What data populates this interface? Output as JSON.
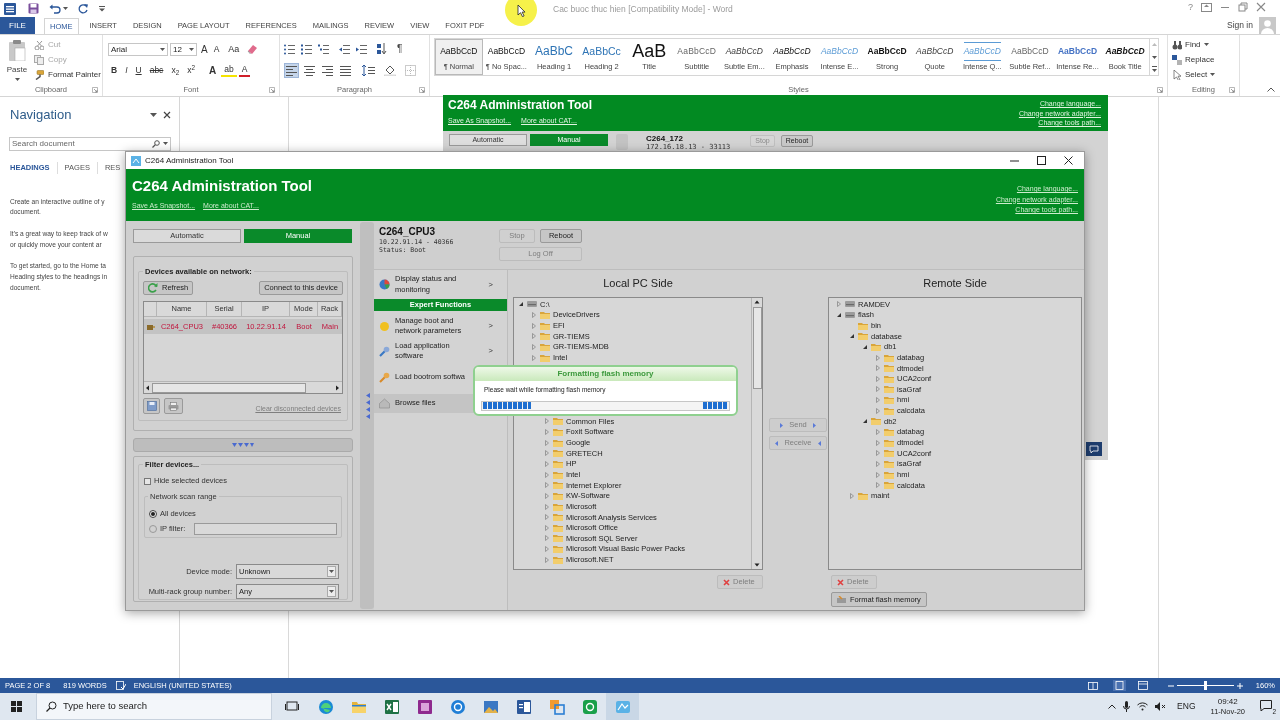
{
  "word": {
    "title": "Cac buoc thuc hien [Compatibility Mode] - Word",
    "help": "?",
    "file_tab": "FILE",
    "tabs": [
      {
        "label": "HOME",
        "selected": true
      },
      {
        "label": "INSERT",
        "selected": false
      },
      {
        "label": "DESIGN",
        "selected": false
      },
      {
        "label": "PAGE LAYOUT",
        "selected": false
      },
      {
        "label": "REFERENCES",
        "selected": false
      },
      {
        "label": "MAILINGS",
        "selected": false
      },
      {
        "label": "REVIEW",
        "selected": false
      },
      {
        "label": "VIEW",
        "selected": false
      },
      {
        "label": "FOXIT PDF",
        "selected": false
      }
    ],
    "sign_in": "Sign in",
    "clipboard": {
      "paste": "Paste",
      "items": [
        {
          "label": "Cut",
          "disabled": true
        },
        {
          "label": "Copy",
          "disabled": true
        },
        {
          "label": "Format Painter",
          "disabled": false
        }
      ],
      "group": "Clipboard"
    },
    "font": {
      "name": "Arial",
      "size": "12",
      "row1": [
        {
          "text": "A",
          "kind": "grow"
        },
        {
          "text": "A",
          "kind": "shrink"
        },
        {
          "text": "Aa",
          "kind": "case"
        }
      ],
      "row2": [
        {
          "text": "B",
          "kind": "bold"
        },
        {
          "text": "I",
          "kind": "italic"
        },
        {
          "text": "U",
          "kind": "underline"
        },
        {
          "text": "abc",
          "kind": "strike"
        },
        {
          "text": "x$_{2}$",
          "kind": "subscript"
        },
        {
          "text": "x$^{2}$",
          "kind": "superscript"
        },
        {
          "text": "A",
          "kind": "effects"
        },
        {
          "text": "ab",
          "kind": "highlight"
        },
        {
          "text": "A",
          "kind": "color"
        }
      ],
      "group": "Font"
    },
    "paragraph": {
      "marks": "¶",
      "alignments": [
        {
          "kind": "left",
          "selected": true
        },
        {
          "kind": "center",
          "selected": false
        },
        {
          "kind": "right",
          "selected": false
        },
        {
          "kind": "justify",
          "selected": false
        }
      ],
      "group": "Paragraph"
    },
    "styles": {
      "items": [
        {
          "preview": "AaBbCcD",
          "label": "¶ Normal",
          "kind": "normal",
          "selected": true
        },
        {
          "preview": "AaBbCcD",
          "label": "¶ No Spac...",
          "kind": "normal",
          "selected": false
        },
        {
          "preview": "AaBbC",
          "label": "Heading 1",
          "kind": "heading1",
          "selected": false
        },
        {
          "preview": "AaBbCc",
          "label": "Heading 2",
          "kind": "heading2",
          "selected": false
        },
        {
          "preview": "AaB",
          "label": "Title",
          "kind": "title",
          "selected": false
        },
        {
          "preview": "AaBbCcD",
          "label": "Subtitle",
          "kind": "subtitle",
          "selected": false
        },
        {
          "preview": "AaBbCcD",
          "label": "Subtle Em...",
          "kind": "subtleemphasis",
          "selected": false
        },
        {
          "preview": "AaBbCcD",
          "label": "Emphasis",
          "kind": "emphasis",
          "selected": false
        },
        {
          "preview": "AaBbCcD",
          "label": "Intense E...",
          "kind": "intenseemphasis",
          "selected": false
        },
        {
          "preview": "AaBbCcD",
          "label": "Strong",
          "kind": "strong",
          "selected": false
        },
        {
          "preview": "AaBbCcD",
          "label": "Quote",
          "kind": "quote",
          "selected": false
        },
        {
          "preview": "AaBbCcD",
          "label": "Intense Q...",
          "kind": "intensequote",
          "selected": false
        },
        {
          "preview": "AaBbCcD",
          "label": "Subtle Ref...",
          "kind": "subtlereference",
          "selected": false
        },
        {
          "preview": "AaBbCcD",
          "label": "Intense Re...",
          "kind": "intensereference",
          "selected": false
        },
        {
          "preview": "AaBbCcD",
          "label": "Book Title",
          "kind": "booktitle",
          "selected": false
        }
      ],
      "group": "Styles"
    },
    "editing": {
      "items": [
        "Find",
        "Replace",
        "Select"
      ],
      "group": "Editing"
    }
  },
  "navigation": {
    "title": "Navigation",
    "search": {
      "placeholder": "Search document"
    },
    "tabs": [
      {
        "label": "HEADINGS",
        "selected": true
      },
      {
        "label": "PAGES",
        "selected": false
      },
      {
        "label": "RES",
        "selected": false
      }
    ],
    "paragraphs": [
      "Create an interactive outline of y\ndocument.",
      "It's a great way to keep track of w\nor quickly move your content ar",
      "To get started, go to the Home ta\nHeading styles to the headings in\ndocument."
    ]
  },
  "background_window": {
    "heading": "C264 Administration Tool",
    "links": [
      "Save As Snapshot...",
      "More about CAT..."
    ],
    "settings_links": [
      "Change language...",
      "Change network adapter...",
      "Change tools path..."
    ],
    "mode_tabs": [
      {
        "label": "Automatic",
        "selected": false
      },
      {
        "label": "Manual",
        "selected": true
      }
    ],
    "device": {
      "name": "C264_172",
      "address": "172.16.18.13 - 33113"
    },
    "buttons": [
      {
        "label": "Stop",
        "disabled": true
      },
      {
        "label": "Reboot",
        "disabled": false
      }
    ]
  },
  "admin_window": {
    "title": "C264 Administration Tool",
    "heading": "C264 Administration Tool",
    "links": [
      "Save As Snapshot...",
      "More about CAT..."
    ],
    "settings_links": [
      "Change language...",
      "Change network adapter...",
      "Change tools path..."
    ],
    "mode_tabs": [
      {
        "label": "Automatic",
        "selected": false
      },
      {
        "label": "Manual",
        "selected": true
      }
    ],
    "devices": {
      "title": "Devices available on network:",
      "refresh": "Refresh",
      "connect": "Connect to this device",
      "columns": [
        "Name",
        "Serial",
        "IP",
        "Mode",
        "Rack"
      ],
      "rows": [
        {
          "cells": [
            "C264_CPU3",
            "#40366",
            "10.22.91.14",
            "Boot",
            "Main"
          ],
          "selected": true
        }
      ],
      "clear_link": "Clear disconnected devices"
    },
    "filter": {
      "title": "Filter devices...",
      "hide_selected": {
        "label": "Hide selected devices",
        "checked": false
      },
      "scan_range": {
        "title": "Network scan range",
        "options": [
          {
            "label": "All devices",
            "selected": true
          },
          {
            "label": "IP filter:",
            "selected": false
          }
        ]
      },
      "device_mode": {
        "label": "Device mode:",
        "value": "Unknown"
      },
      "rack_group": {
        "label": "Multi-rack group number:",
        "value": "Any"
      }
    },
    "device": {
      "name": "C264_CPU3",
      "address": "10.22.91.14 - 40366",
      "status": "Status: Boot",
      "buttons": [
        {
          "label": "Stop",
          "disabled": true
        },
        {
          "label": "Reboot",
          "disabled": false
        },
        {
          "label": "Log Off",
          "disabled": true
        }
      ]
    },
    "menu": [
      {
        "label": "Display status and monitoring",
        "arrow": ">",
        "selected": false
      }
    ],
    "expert_header": "Expert Functions",
    "expert_menu": [
      {
        "label": "Manage boot and network parameters",
        "arrow": ">",
        "selected": false
      },
      {
        "label": "Load application software",
        "arrow": ">",
        "selected": false
      },
      {
        "label": "Load bootrom softwa",
        "selected": false
      },
      {
        "label": "Browse files",
        "selected": true
      }
    ],
    "local": {
      "title": "Local PC Side",
      "tree": [
        {
          "label": "C:\\",
          "kind": "drive",
          "expanded": true,
          "children": [
            {
              "label": "DeviceDrivers",
              "kind": "folder",
              "expanded": false
            },
            {
              "label": "EFI",
              "kind": "folder",
              "expanded": false
            },
            {
              "label": "GR-TIEMS",
              "kind": "folder",
              "expanded": false
            },
            {
              "label": "GR-TIEMS-MDB",
              "kind": "folder",
              "expanded": false
            },
            {
              "label": "Intel",
              "kind": "folder",
              "expanded": false
            }
          ]
        }
      ],
      "tree_continued": [
        {
          "label": "Common Files",
          "kind": "folder",
          "expanded": false
        },
        {
          "label": "Foxit Software",
          "kind": "folder",
          "expanded": false
        },
        {
          "label": "Google",
          "kind": "folder",
          "expanded": false
        },
        {
          "label": "GRETECH",
          "kind": "folder",
          "expanded": false
        },
        {
          "label": "HP",
          "kind": "folder",
          "expanded": false
        },
        {
          "label": "Intel",
          "kind": "folder",
          "expanded": false
        },
        {
          "label": "Internet Explorer",
          "kind": "folder",
          "expanded": false
        },
        {
          "label": "KW-Software",
          "kind": "folder",
          "expanded": false
        },
        {
          "label": "Microsoft",
          "kind": "folder",
          "expanded": false
        },
        {
          "label": "Microsoft Analysis Services",
          "kind": "folder",
          "expanded": false
        },
        {
          "label": "Microsoft Office",
          "kind": "folder",
          "expanded": false
        },
        {
          "label": "Microsoft SQL Server",
          "kind": "folder",
          "expanded": false
        },
        {
          "label": "Microsoft Visual Basic Power Packs",
          "kind": "folder",
          "expanded": false
        },
        {
          "label": "Microsoft.NET",
          "kind": "folder",
          "expanded": false
        }
      ],
      "delete": {
        "label": "Delete",
        "disabled": true
      }
    },
    "transfer": [
      {
        "label": "Send",
        "kind": "send",
        "disabled": true
      },
      {
        "label": "Receive",
        "kind": "receive",
        "disabled": true
      }
    ],
    "remote": {
      "title": "Remote Side",
      "tree": [
        {
          "label": "RAMDEV",
          "kind": "drive",
          "expanded": false
        },
        {
          "label": "flash",
          "kind": "drive",
          "expanded": true,
          "children": [
            {
              "label": "bin",
              "kind": "folder"
            },
            {
              "label": "database",
              "kind": "folder",
              "expanded": true,
              "children": [
                {
                  "label": "db1",
                  "kind": "folder",
                  "expanded": true,
                  "children": [
                    {
                      "label": "databag",
                      "kind": "folder",
                      "expanded": false
                    },
                    {
                      "label": "dtmodel",
                      "kind": "folder",
                      "expanded": false
                    },
                    {
                      "label": "UCA2conf",
                      "kind": "folder",
                      "expanded": false
                    },
                    {
                      "label": "isaGraf",
                      "kind": "folder",
                      "expanded": false
                    },
                    {
                      "label": "hmi",
                      "kind": "folder",
                      "expanded": false
                    },
                    {
                      "label": "calcdata",
                      "kind": "folder",
                      "expanded": false
                    }
                  ]
                },
                {
                  "label": "db2",
                  "kind": "folder",
                  "expanded": true,
                  "children": [
                    {
                      "label": "databag",
                      "kind": "folder",
                      "expanded": false
                    },
                    {
                      "label": "dtmodel",
                      "kind": "folder",
                      "expanded": false
                    },
                    {
                      "label": "UCA2conf",
                      "kind": "folder",
                      "expanded": false
                    },
                    {
                      "label": "isaGraf",
                      "kind": "folder",
                      "expanded": false
                    },
                    {
                      "label": "hmi",
                      "kind": "folder",
                      "expanded": false
                    },
                    {
                      "label": "calcdata",
                      "kind": "folder",
                      "expanded": false
                    }
                  ]
                }
              ]
            },
            {
              "label": "maint",
              "kind": "folder",
              "expanded": false
            }
          ]
        }
      ],
      "delete": {
        "label": "Delete",
        "disabled": true
      },
      "format": "Format flash memory"
    }
  },
  "dialog": {
    "title": "Formatting flash memory",
    "message": "Please wait while formatting flash memory"
  },
  "status_bar": {
    "page": "PAGE 2 OF 8",
    "words": "819 WORDS",
    "language": "ENGLISH (UNITED STATES)",
    "zoom": "160%",
    "zoom_slider": {
      "level": 0.5
    }
  },
  "taskbar": {
    "search": {
      "placeholder": "Type here to search"
    },
    "language": "ENG",
    "time": "09:42",
    "date": "11-Nov-20",
    "notifications": "2"
  }
}
